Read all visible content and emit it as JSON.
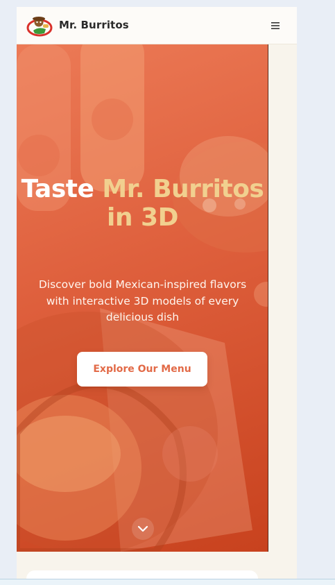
{
  "navbar": {
    "brand": "Mr. Burritos",
    "logo_icon": "mascot-logo-icon",
    "menu_icon": "hamburger-icon"
  },
  "hero": {
    "title_part1": "Taste",
    "title_part2": "Mr. Burritos",
    "title_part3": "in 3D",
    "subtitle": "Discover bold Mexican-inspired flavors with interactive 3D models of every delicious dish",
    "cta_label": "Explore Our Menu",
    "scroll_icon": "chevron-down-icon"
  },
  "colors": {
    "accent": "#e26a47",
    "gold": "#f1d08f",
    "hero_start": "#ec7a56",
    "hero_end": "#c8421e"
  }
}
